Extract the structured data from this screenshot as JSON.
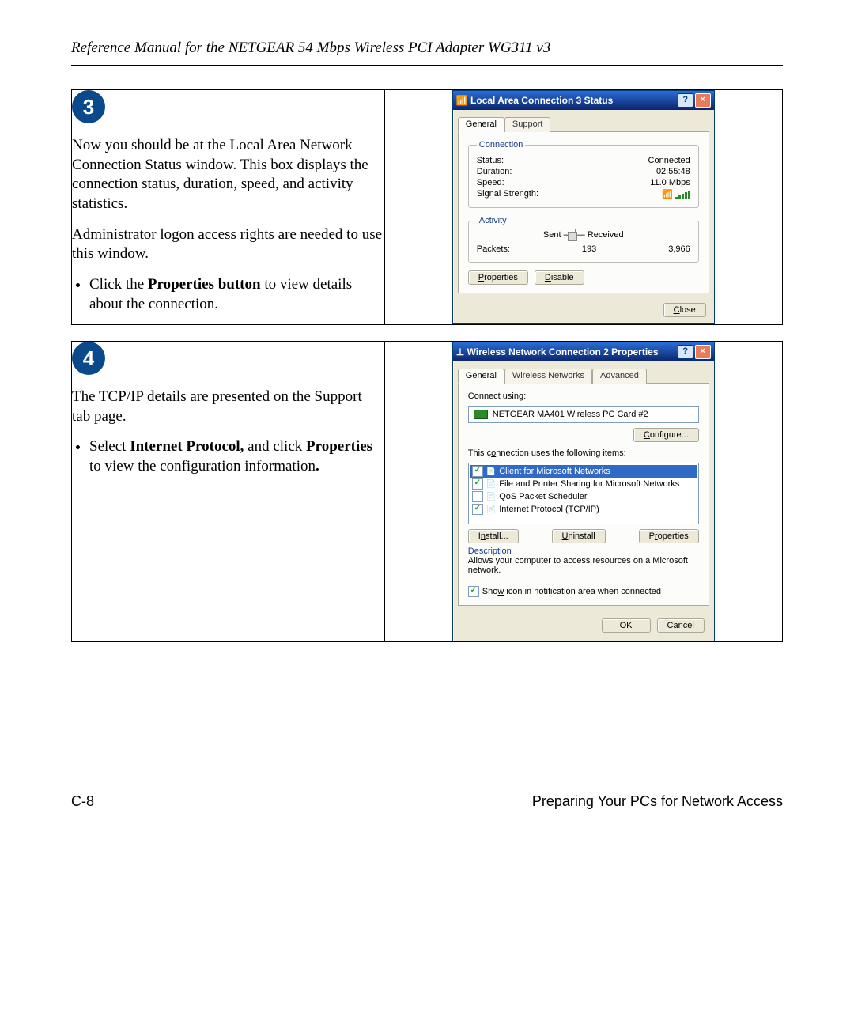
{
  "header": "Reference Manual for the NETGEAR 54 Mbps Wireless PCI Adapter WG311 v3",
  "footer": {
    "left": "C-8",
    "right": "Preparing Your PCs for Network Access"
  },
  "step3": {
    "badge": "3",
    "p1": "Now you should be at the Local Area Network Connection Status window. This box displays the connection status, duration, speed, and activity statistics.",
    "p2": "Administrator logon access rights are needed to use this window.",
    "bullet_pre": "Click the ",
    "bullet_bold": "Properties button",
    "bullet_post": " to view details about the connection."
  },
  "dlg1": {
    "title": "Local Area Connection 3 Status",
    "tab_general": "General",
    "tab_support": "Support",
    "grp_conn": "Connection",
    "lbl_status": "Status:",
    "val_status": "Connected",
    "lbl_duration": "Duration:",
    "val_duration": "02:55:48",
    "lbl_speed": "Speed:",
    "val_speed": "11.0 Mbps",
    "lbl_signal": "Signal Strength:",
    "grp_act": "Activity",
    "lbl_sent": "Sent",
    "lbl_recv": "Received",
    "lbl_packets": "Packets:",
    "val_sent": "193",
    "val_recv": "3,966",
    "btn_props": "Properties",
    "btn_disable": "Disable",
    "btn_close": "Close"
  },
  "step4": {
    "badge": "4",
    "p1": "The TCP/IP details are presented on the Support tab page.",
    "bullet_pre": "Select ",
    "bullet_b1": "Internet Protocol,",
    "bullet_mid": " and click ",
    "bullet_b2": "Properties",
    "bullet_post": " to view the configuration information",
    "bullet_dot": "."
  },
  "dlg2": {
    "title": "Wireless Network Connection 2 Properties",
    "tab_general": "General",
    "tab_wireless": "Wireless Networks",
    "tab_adv": "Advanced",
    "lbl_connect_using": "Connect using:",
    "device": "NETGEAR MA401 Wireless PC Card #2",
    "btn_configure": "Configure...",
    "lbl_items": "This connection uses the following items:",
    "items": [
      {
        "checked": true,
        "sel": true,
        "label": "Client for Microsoft Networks"
      },
      {
        "checked": true,
        "sel": false,
        "label": "File and Printer Sharing for Microsoft Networks"
      },
      {
        "checked": false,
        "sel": false,
        "label": "QoS Packet Scheduler"
      },
      {
        "checked": true,
        "sel": false,
        "label": "Internet Protocol (TCP/IP)"
      }
    ],
    "btn_install": "Install...",
    "btn_uninstall": "Uninstall",
    "btn_props": "Properties",
    "grp_desc": "Description",
    "desc_text": "Allows your computer to access resources on a Microsoft network.",
    "chk_tray": "Show icon in notification area when connected",
    "btn_ok": "OK",
    "btn_cancel": "Cancel"
  }
}
